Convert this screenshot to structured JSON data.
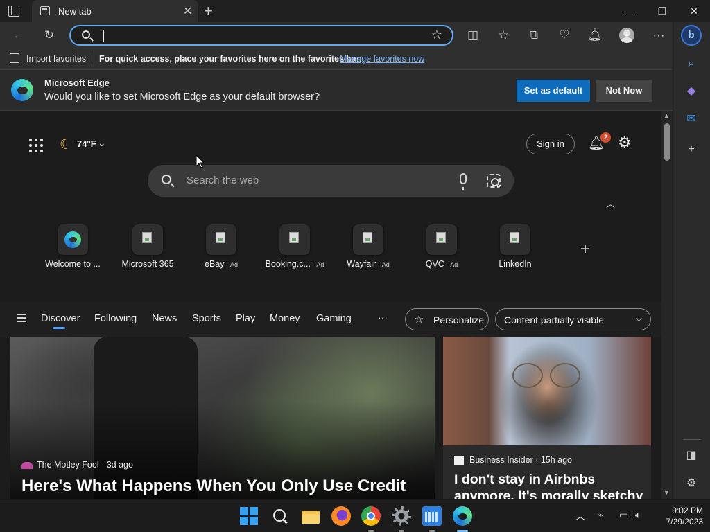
{
  "browser": {
    "tab_title": "New tab",
    "address_value": "",
    "favorites_bar": {
      "import_label": "Import favorites",
      "message": "For quick access, place your favorites here on the favorites bar.",
      "link": "Manage favorites now"
    },
    "infobar": {
      "title": "Microsoft Edge",
      "text": "Would you like to set Microsoft Edge as your default browser?",
      "primary_button": "Set as default",
      "secondary_button": "Not Now"
    },
    "sidebar_bing_label": "b"
  },
  "newtab": {
    "weather_temp": "74°F",
    "sign_in": "Sign in",
    "notification_count": "2",
    "search_placeholder": "Search the web",
    "quick_links": [
      {
        "label": "Welcome to ...",
        "ad": ""
      },
      {
        "label": "Microsoft 365",
        "ad": ""
      },
      {
        "label": "eBay",
        "ad": "· Ad"
      },
      {
        "label": "Booking.c...",
        "ad": "· Ad"
      },
      {
        "label": "Wayfair",
        "ad": "· Ad"
      },
      {
        "label": "QVC",
        "ad": "· Ad"
      },
      {
        "label": "LinkedIn",
        "ad": ""
      }
    ],
    "feed_tabs": [
      "Discover",
      "Following",
      "News",
      "Sports",
      "Play",
      "Money",
      "Gaming"
    ],
    "more_label": "···",
    "personalize_label": "Personalize",
    "content_visibility": "Content partially visible",
    "cards": [
      {
        "source": "The Motley Fool · 3d ago",
        "title": "Here's What Happens When You Only Use Credit"
      },
      {
        "source": "Business Insider · 15h ago",
        "title": "I don't stay in Airbnbs anymore. It's morally sketchy"
      }
    ]
  },
  "taskbar": {
    "time": "9:02 PM",
    "date": "7/29/2023"
  }
}
